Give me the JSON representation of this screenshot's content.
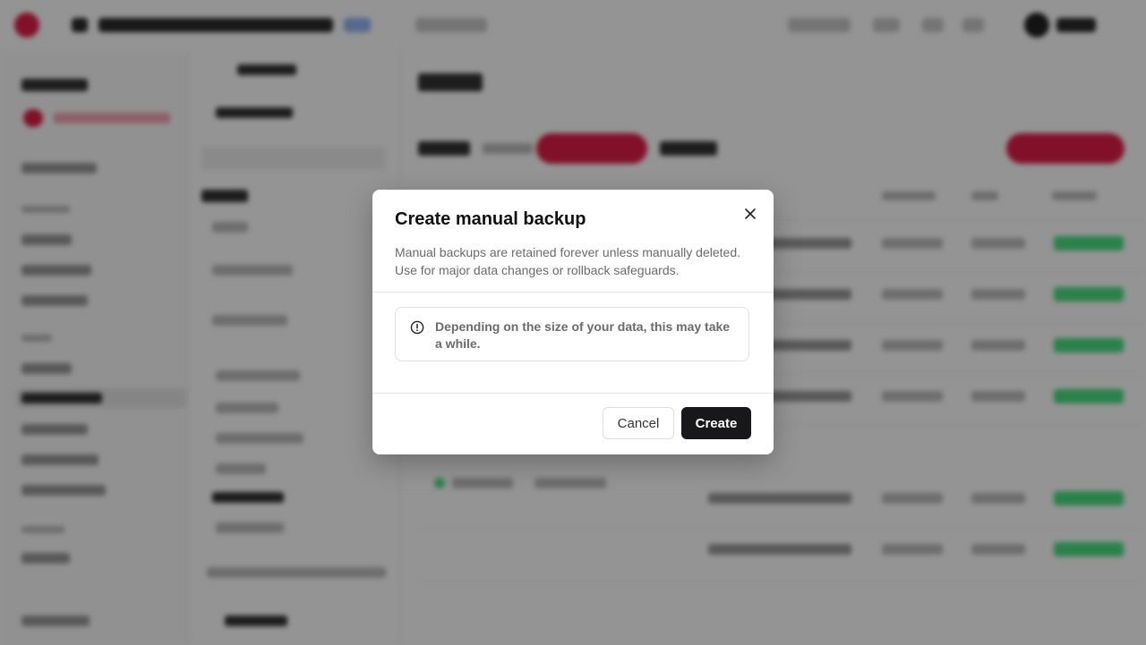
{
  "dialog": {
    "title": "Create manual backup",
    "description": "Manual backups are retained forever unless manually deleted. Use for major data changes or rollback safeguards.",
    "alert_text": "Depending on the size of your data, this may take a while.",
    "cancel_label": "Cancel",
    "create_label": "Create",
    "close_icon": "close-icon",
    "alert_icon": "alert-circle-icon"
  },
  "background": {
    "page_title": "Backups",
    "section_title": "Backups",
    "colors": {
      "brand": "#e11d48",
      "status_green": "#4ade80"
    }
  }
}
